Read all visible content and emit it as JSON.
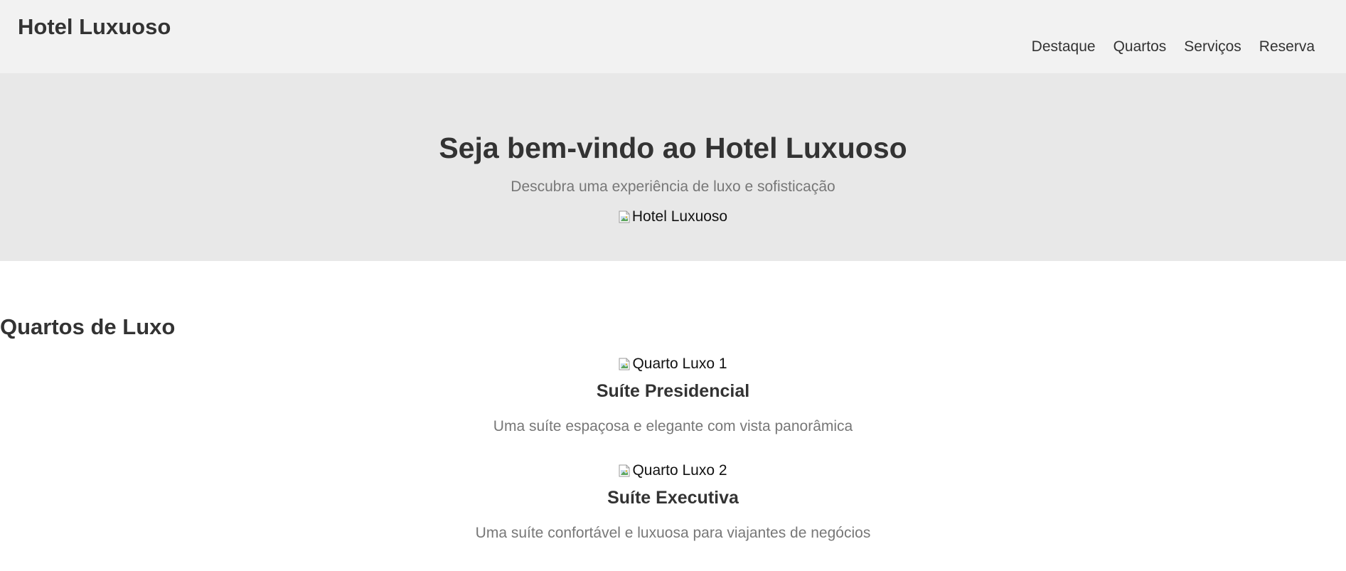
{
  "header": {
    "logo": "Hotel Luxuoso",
    "nav": [
      {
        "label": "Destaque"
      },
      {
        "label": "Quartos"
      },
      {
        "label": "Serviços"
      },
      {
        "label": "Reserva"
      }
    ]
  },
  "hero": {
    "title": "Seja bem-vindo ao Hotel Luxuoso",
    "subtitle": "Descubra uma experiência de luxo e sofisticação",
    "image_alt": "Hotel Luxuoso"
  },
  "rooms": {
    "title": "Quartos de Luxo",
    "items": [
      {
        "image_alt": "Quarto Luxo 1",
        "name": "Suíte Presidencial",
        "description": "Uma suíte espaçosa e elegante com vista panorâmica"
      },
      {
        "image_alt": "Quarto Luxo 2",
        "name": "Suíte Executiva",
        "description": "Uma suíte confortável e luxuosa para viajantes de negócios"
      }
    ]
  },
  "colors": {
    "header_bg": "#f2f2f2",
    "hero_bg": "#e8e8e8",
    "text": "#333333",
    "muted_text": "#777777"
  }
}
